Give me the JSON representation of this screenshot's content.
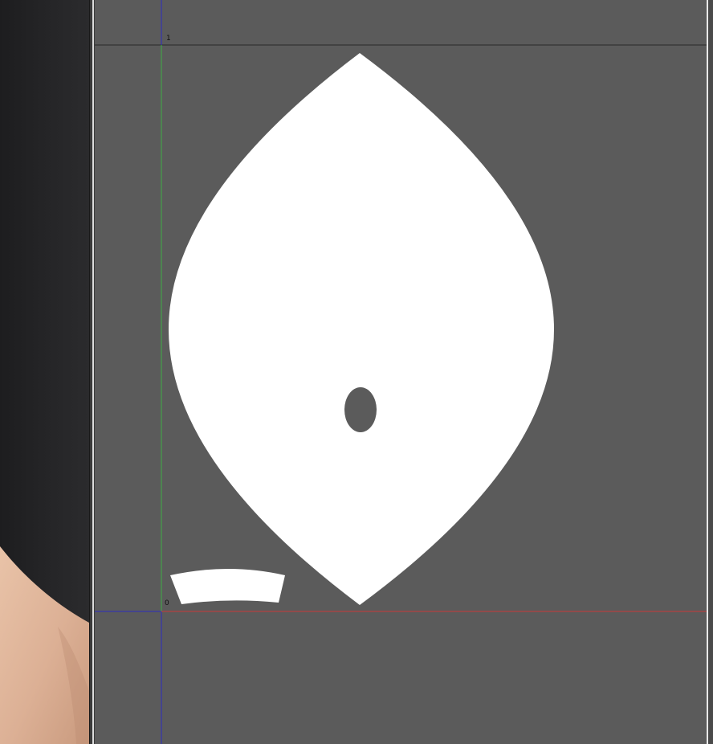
{
  "viewport_3d": {
    "content": "character-arm-preview",
    "background": "#232325",
    "skin_color": "#e2b89e"
  },
  "uv_editor": {
    "background": "#5b5b5b",
    "axis_colors": {
      "u_axis": "#c83a3a",
      "v_axis": "#3fae46",
      "frame": "#2e2ec0",
      "top_bound": "#2a2a2a"
    },
    "labels": {
      "top_value": "1",
      "origin_value": "0"
    },
    "islands": [
      {
        "name": "lens-island",
        "fill": "#ffffff",
        "hole_fill": "#5b5b5b"
      },
      {
        "name": "strip-island",
        "fill": "#ffffff"
      }
    ]
  }
}
